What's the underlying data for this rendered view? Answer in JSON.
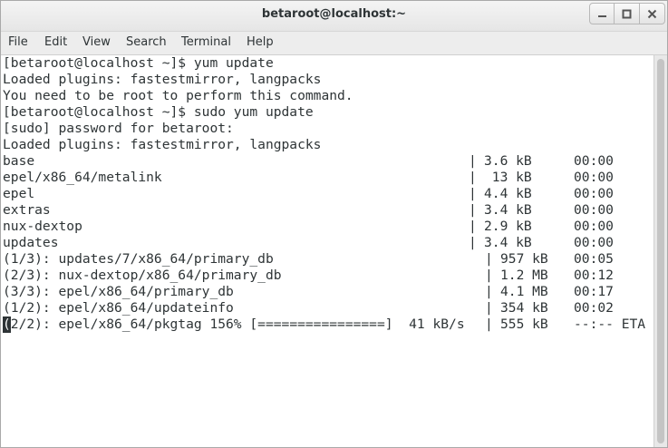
{
  "window": {
    "title": "betaroot@localhost:~"
  },
  "menu": [
    "File",
    "Edit",
    "View",
    "Search",
    "Terminal",
    "Help"
  ],
  "terminal": {
    "lines": [
      {
        "text": "[betaroot@localhost ~]$ yum update"
      },
      {
        "text": "Loaded plugins: fastestmirror, langpacks"
      },
      {
        "text": "You need to be root to perform this command."
      },
      {
        "text": "[betaroot@localhost ~]$ sudo yum update"
      },
      {
        "text": "[sudo] password for betaroot:"
      },
      {
        "text": "Loaded plugins: fastestmirror, langpacks"
      },
      {
        "name": "base",
        "size": "3.6 kB",
        "time": "00:00"
      },
      {
        "name": "epel/x86_64/metalink",
        "size": " 13 kB",
        "time": "00:00"
      },
      {
        "name": "epel",
        "size": "4.4 kB",
        "time": "00:00"
      },
      {
        "name": "extras",
        "size": "3.4 kB",
        "time": "00:00"
      },
      {
        "name": "nux-dextop",
        "size": "2.9 kB",
        "time": "00:00"
      },
      {
        "name": "updates",
        "size": "3.4 kB",
        "time": "00:00"
      },
      {
        "name": "(1/3): updates/7/x86_64/primary_db",
        "size": "957 kB",
        "time": "00:05"
      },
      {
        "name": "(2/3): nux-dextop/x86_64/primary_db",
        "size": "1.2 MB",
        "time": "00:12"
      },
      {
        "name": "(3/3): epel/x86_64/primary_db",
        "size": "4.1 MB",
        "time": "00:17"
      },
      {
        "name": "(1/2): epel/x86_64/updateinfo",
        "size": "354 kB",
        "time": "00:02"
      },
      {
        "cursor_char": "(",
        "name": "2/2): epel/x86_64/pkgtag 156% [================]  41 kB/s",
        "size": "555 kB",
        "time": "--:-- ETA"
      }
    ]
  }
}
